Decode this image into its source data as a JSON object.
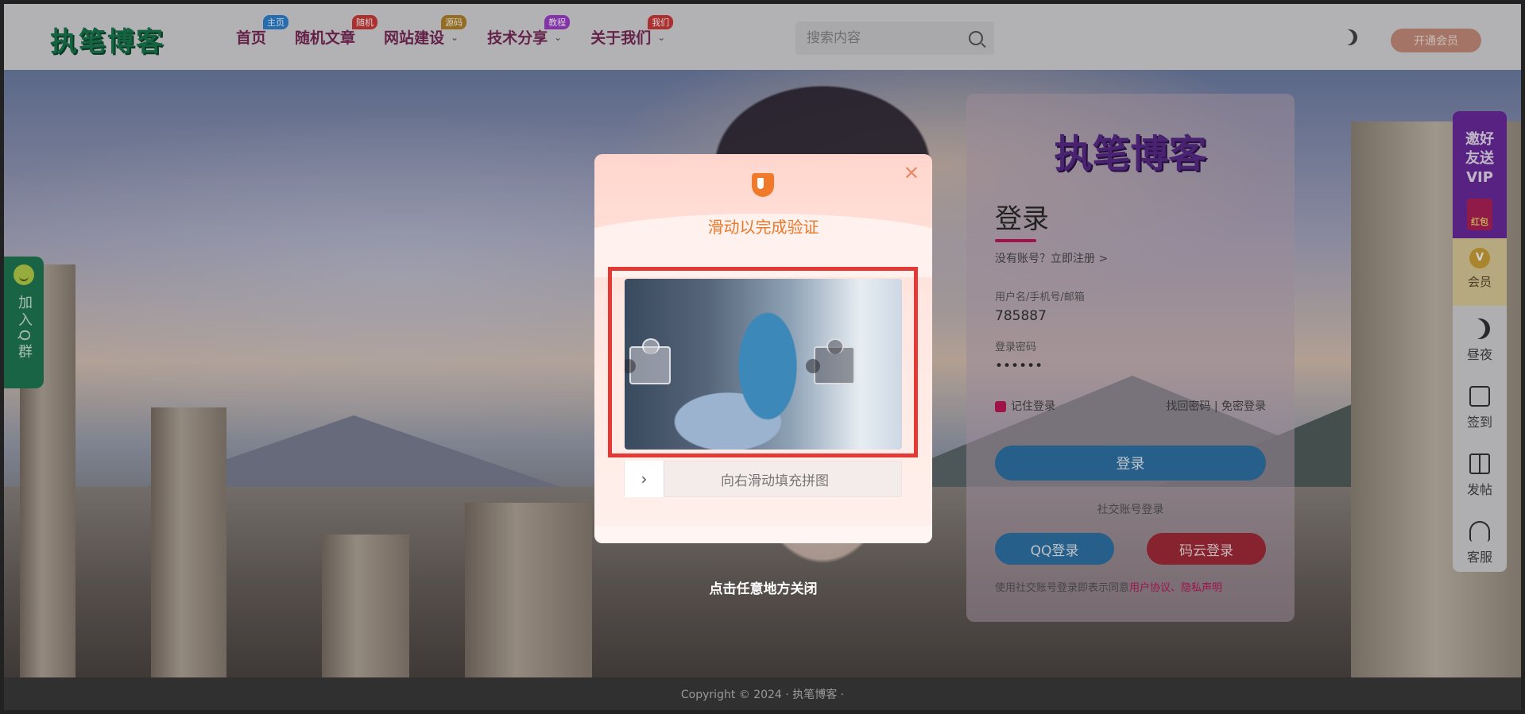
{
  "header": {
    "logo": "执笔博客",
    "nav": [
      {
        "label": "首页",
        "badge": "主页",
        "badge_color": "#2e86d6",
        "dropdown": false
      },
      {
        "label": "随机文章",
        "badge": "随机",
        "badge_color": "#d43b3b",
        "dropdown": false
      },
      {
        "label": "网站建设",
        "badge": "源码",
        "badge_color": "#b5862a",
        "dropdown": true
      },
      {
        "label": "技术分享",
        "badge": "教程",
        "badge_color": "#a13ecf",
        "dropdown": true
      },
      {
        "label": "关于我们",
        "badge": "我们",
        "badge_color": "#d43b3b",
        "dropdown": true
      }
    ],
    "search_placeholder": "搜索内容",
    "vip_button": "开通会员"
  },
  "left_float": {
    "label": "加入Q群"
  },
  "right_bar": {
    "invite": "邀好友送VIP",
    "envelope": "红包",
    "member": "会员",
    "member_coin": "V",
    "items": [
      "昼夜",
      "签到",
      "发帖",
      "客服"
    ]
  },
  "login": {
    "logo": "执笔博客",
    "title": "登录",
    "register_prompt": "没有账号？立即注册 >",
    "username_label": "用户名/手机号/邮箱",
    "username_value": "785887",
    "password_label": "登录密码",
    "password_value": "••••••",
    "remember": "记住登录",
    "forgot": "找回密码 | 免密登录",
    "login_button": "登录",
    "social_title": "社交账号登录",
    "qq_button": "QQ登录",
    "gitee_button": "码云登录",
    "agreement_prefix": "使用社交账号登录即表示同意",
    "agreement_link": "用户协议、隐私声明"
  },
  "footer": {
    "text": "Copyright © 2024 · 执笔博客 ·"
  },
  "captcha": {
    "title": "滑动以完成验证",
    "slider_text": "向右滑动填充拼图",
    "close_hint": "点击任意地方关闭"
  },
  "colors": {
    "accent_orange": "#e8782a",
    "highlight_red": "#e53935",
    "brand_pink": "#c2185b"
  }
}
